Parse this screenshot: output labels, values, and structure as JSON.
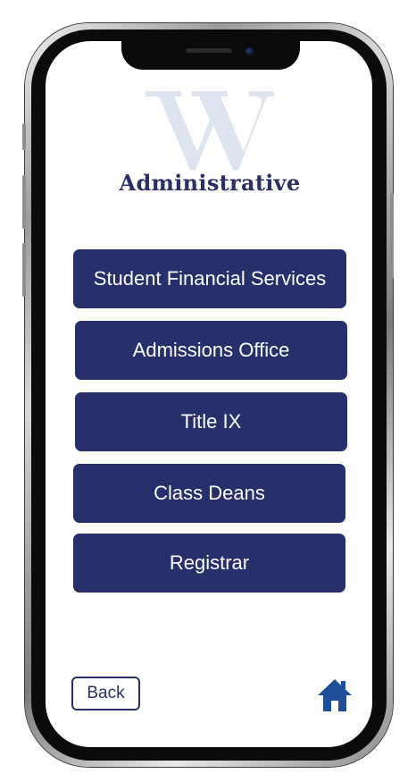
{
  "app": {
    "logo_letter": "W",
    "title": "Administrative"
  },
  "menu": {
    "items": [
      {
        "label": "Student Financial Services"
      },
      {
        "label": "Admissions Office"
      },
      {
        "label": "Title IX"
      },
      {
        "label": "Class Deans"
      },
      {
        "label": "Registrar"
      }
    ]
  },
  "footer": {
    "back_label": "Back",
    "home_icon": "home-icon"
  },
  "colors": {
    "primary": "#27306b",
    "logo_tint": "#dde3ef",
    "background": "#ffffff"
  }
}
